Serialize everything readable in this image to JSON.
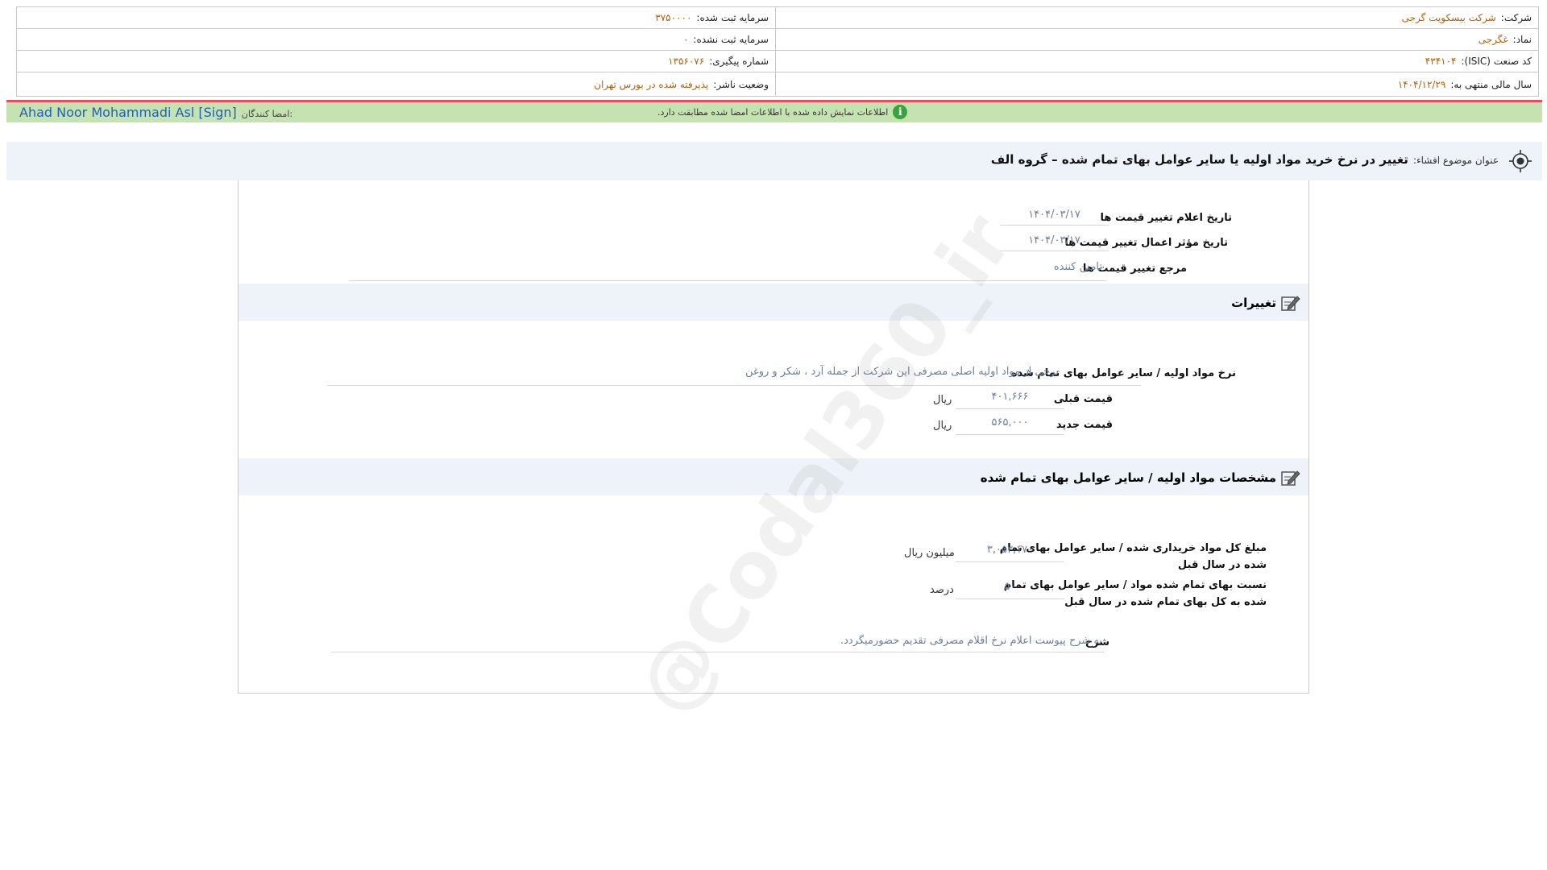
{
  "company": {
    "company_label": "شرکت:",
    "company_value": "شرکت بیسکویت گرجی",
    "symbol_label": "نماد:",
    "symbol_value": "غگرجی",
    "isic_label": "کد صنعت (ISIC):",
    "isic_value": "۴۳۴۱۰۴",
    "fiscal_label": "سال مالی منتهی به:",
    "fiscal_value": "۱۴۰۴/۱۲/۲۹",
    "registered_capital_label": "سرمایه ثبت شده:",
    "registered_capital_value": "۳۷۵۰۰۰۰",
    "unregistered_capital_label": "سرمایه ثبت نشده:",
    "unregistered_capital_value": "۰",
    "tracking_label": "شماره پیگیری:",
    "tracking_value": "۱۳۵۶۰۷۶",
    "status_label": "وضعیت ناشر:",
    "status_value": "پذیرفته شده در بورس تهران"
  },
  "signature": {
    "signers_label": "امضا کنندگان:",
    "signers_value": "Ahad Noor Mohammadi Asl [Sign]",
    "info_message": "اطلاعات نمایش داده شده با اطلاعات امضا شده مطابقت دارد.",
    "info_icon_glyph": "i"
  },
  "title": {
    "label": "عنوان موضوع افشاء:",
    "value": "تغییر در نرخ خرید مواد اولیه یا سایر عوامل بهای تمام شده – گروه الف"
  },
  "dates": {
    "announce_label": "تاریخ اعلام تغییر قیمت ها",
    "announce_value": "۱۴۰۴/۰۳/۱۷",
    "effective_label": "تاریخ مؤثر اعمال تغییر قیمت ها",
    "effective_value": "۱۴۰۴/۰۳/۱۷",
    "reference_label": "مرجع تغییر قیمت ها",
    "reference_value": "تامین کننده"
  },
  "changes": {
    "section_title": "تغییرات",
    "rate_label": "نرخ مواد اولیه / سایر عوامل بهای تمام شده",
    "rate_value": "برخی از مواد اولیه اصلی مصرفی این شرکت از جمله آرد ، شکر و روغن",
    "prev_price_label": "قیمت قبلی",
    "prev_price_value": "۴۰۱,۶۶۶",
    "prev_price_unit": "ریال",
    "new_price_label": "قیمت جدید",
    "new_price_value": "۵۶۵,۰۰۰",
    "new_price_unit": "ریال"
  },
  "specs": {
    "section_title": "مشخصات مواد اولیه / سایر عوامل بهای تمام شده",
    "total_label_line1": "مبلغ کل مواد خریداری شده / سایر عوامل بهای تمام",
    "total_label_line2": "شده در سال قبل",
    "total_value": "۳,۰۵۳,۱۷۰",
    "total_unit": "میلیون ریال",
    "ratio_label_line1": "نسبت بهای تمام شده مواد / سایر عوامل بهای تمام",
    "ratio_label_line2": "شده به کل بهای تمام شده در سال قبل",
    "ratio_value": "۵۰",
    "ratio_unit": "درصد",
    "desc_label": "شرح",
    "desc_value": "به شرح پیوست اعلام نرخ اقلام مصرفی تقدیم حضورمیگردد."
  },
  "watermark": {
    "text": "@Codal360_ir"
  },
  "colors": {
    "value_orange": "#b4610a",
    "signature_green": "#c4e3b1",
    "signature_top_border": "#e0505f",
    "signer_blue": "#1f5fbf",
    "section_bg": "#eef3f9",
    "field_value": "#6b7f99"
  }
}
